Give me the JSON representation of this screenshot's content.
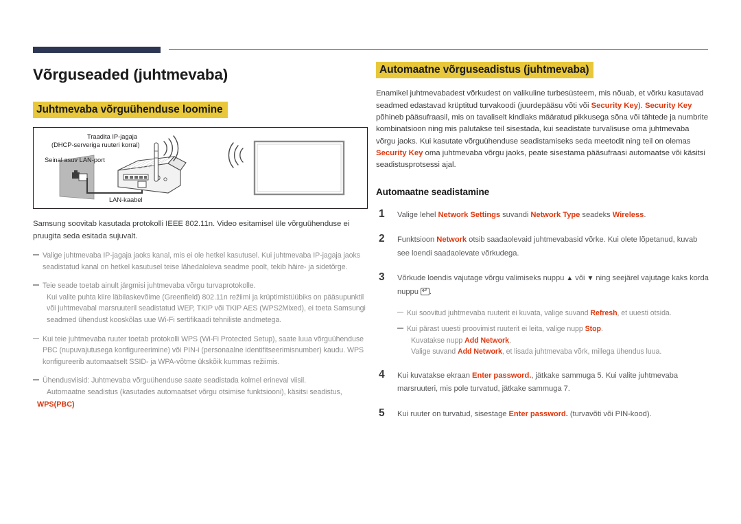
{
  "header": {
    "navy_bar": "",
    "rule": "",
    "accent_navy": "#2d3653",
    "accent_highlight": "#e8c83a",
    "accent_red": "#e0380e"
  },
  "left": {
    "title": "Võrguseaded (juhtmevaba)",
    "section_heading": "Juhtmevaba võrguühenduse loomine",
    "diagram": {
      "label_router_line1": "Traadita IP-jagaja",
      "label_router_line2": "(DHCP-serveriga ruuteri korral)",
      "label_lan_port": "Seinal asuv LAN-port",
      "label_lan_cable": "LAN-kaabel"
    },
    "intro": "Samsung soovitab kasutada protokolli IEEE 802.11n. Video esitamisel üle võrguühenduse ei pruugita seda esitada sujuvalt.",
    "notes": [
      {
        "text": "Valige juhtmevaba IP-jagaja jaoks kanal, mis ei ole hetkel kasutusel. Kui juhtmevaba IP-jagaja jaoks seadistatud kanal on hetkel kasutusel teise lähedaloleva seadme poolt, tekib häire- ja sidetõrge.",
        "cont": []
      },
      {
        "text": "Teie seade toetab ainult järgmisi juhtmevaba võrgu turvaprotokolle.",
        "cont": [
          "Kui valite puhta kiire läbilaskevõime (Greenfield) 802.11n režiimi ja krüptimistüübiks on pääsupunktil või juhtmevabal marsruuteril seadistatud WEP, TKIP või TKIP AES (WPS2Mixed), ei toeta Samsungi seadmed ühendust kooskõlas uue Wi-Fi sertifikaadi tehniliste andmetega."
        ]
      },
      {
        "text": "Kui teie juhtmevaba ruuter toetab protokolli WPS (Wi-Fi Protected Setup), saate luua võrguühenduse PBC (nupuvajutusega konfigureerimine) või PIN-i (personaalne identifitseerimisnumber) kaudu. WPS konfigureerib automaatselt SSID- ja WPA-võtme ükskõik kummas režiimis.",
        "cont": []
      },
      {
        "text": "Ühendusviisid: Juhtmevaba võrguühenduse saate seadistada kolmel erineval viisil.",
        "cont": [
          "Automaatne seadistus (kasutades automaatset võrgu otsimise funktsiooni), käsitsi seadistus,"
        ]
      }
    ],
    "wps_tag": "WPS(PBC)"
  },
  "right": {
    "section_heading": "Automaatne võrguseadistus (juhtmevaba)",
    "intro_parts": [
      {
        "t": "Enamikel juhtmevabadest võrkudest on valikuline turbesüsteem, mis nõuab, et võrku kasutavad seadmed edastavad krüptitud turvakoodi (juurdepääsu võti või ",
        "s": "plain"
      },
      {
        "t": "Security Key",
        "s": "red"
      },
      {
        "t": "). ",
        "s": "plain"
      },
      {
        "t": "Security Key",
        "s": "red"
      },
      {
        "t": " põhineb pääsufraasil, mis on tavaliselt kindlaks määratud pikkusega sõna või tähtede ja numbrite kombinatsioon ning mis palutakse teil sisestada, kui seadistate turvalisuse oma juhtmevaba võrgu jaoks. Kui kasutate võrguühenduse seadistamiseks seda meetodit ning teil on olemas ",
        "s": "plain"
      },
      {
        "t": "Security Key",
        "s": "red"
      },
      {
        "t": " oma juhtmevaba võrgu jaoks, peate sisestama pääsufraasi automaatse või käsitsi seadistusprotsessi ajal.",
        "s": "plain"
      }
    ],
    "sub_heading": "Automaatne seadistamine",
    "steps": [
      {
        "num": "1",
        "parts": [
          {
            "t": "Valige lehel ",
            "s": "plain"
          },
          {
            "t": "Network Settings",
            "s": "red"
          },
          {
            "t": " suvandi ",
            "s": "plain"
          },
          {
            "t": "Network Type",
            "s": "red"
          },
          {
            "t": " seadeks ",
            "s": "plain"
          },
          {
            "t": "Wireless",
            "s": "red"
          },
          {
            "t": ".",
            "s": "plain"
          }
        ]
      },
      {
        "num": "2",
        "parts": [
          {
            "t": "Funktsioon ",
            "s": "plain"
          },
          {
            "t": "Network",
            "s": "red"
          },
          {
            "t": " otsib saadaolevaid juhtmevabasid võrke. Kui olete lõpetanud, kuvab see loendi saadaolevate võrkudega.",
            "s": "plain"
          }
        ]
      },
      {
        "num": "3",
        "parts": [
          {
            "t": "Võrkude loendis vajutage võrgu valimiseks nuppu ",
            "s": "plain"
          },
          {
            "t": "▲",
            "s": "key"
          },
          {
            "t": " või ",
            "s": "plain"
          },
          {
            "t": "▼",
            "s": "key"
          },
          {
            "t": " ning seejärel vajutage kaks korda nuppu ",
            "s": "plain"
          },
          {
            "t": "",
            "s": "enterkey"
          },
          {
            "t": ".",
            "s": "plain"
          }
        ]
      }
    ],
    "step3_notes": [
      {
        "parts": [
          {
            "t": "Kui soovitud juhtmevaba ruuterit ei kuvata, valige suvand ",
            "s": "plain"
          },
          {
            "t": "Refresh",
            "s": "red"
          },
          {
            "t": ", et uuesti otsida.",
            "s": "plain"
          }
        ],
        "cont": []
      },
      {
        "parts": [
          {
            "t": "Kui pärast uuesti proovimist ruuterit ei leita, valige nupp ",
            "s": "plain"
          },
          {
            "t": "Stop",
            "s": "red"
          },
          {
            "t": ".",
            "s": "plain"
          }
        ],
        "cont": [
          [
            {
              "t": "Kuvatakse nupp ",
              "s": "plain"
            },
            {
              "t": "Add Network",
              "s": "red"
            },
            {
              "t": ".",
              "s": "plain"
            }
          ],
          [
            {
              "t": "Valige suvand ",
              "s": "plain"
            },
            {
              "t": "Add Network",
              "s": "red"
            },
            {
              "t": ", et lisada juhtmevaba võrk, millega ühendus luua.",
              "s": "plain"
            }
          ]
        ]
      }
    ],
    "steps_tail": [
      {
        "num": "4",
        "parts": [
          {
            "t": "Kui kuvatakse ekraan ",
            "s": "plain"
          },
          {
            "t": "Enter password.",
            "s": "red"
          },
          {
            "t": ", jätkake sammuga 5. Kui valite juhtmevaba marsruuteri, mis pole turvatud, jätkake sammuga 7.",
            "s": "plain"
          }
        ]
      },
      {
        "num": "5",
        "parts": [
          {
            "t": "Kui ruuter on turvatud, sisestage ",
            "s": "plain"
          },
          {
            "t": "Enter password.",
            "s": "red"
          },
          {
            "t": " (turvavõti või PIN-kood).",
            "s": "plain"
          }
        ]
      }
    ]
  }
}
